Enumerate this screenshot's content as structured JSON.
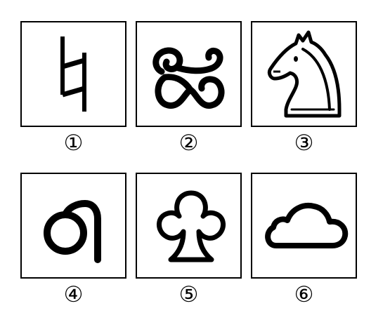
{
  "figures": [
    {
      "number": "①",
      "icon": "natural-sign-icon"
    },
    {
      "number": "②",
      "icon": "script-glyph-icon"
    },
    {
      "number": "③",
      "icon": "chess-knight-icon"
    },
    {
      "number": "④",
      "icon": "script-loop-icon"
    },
    {
      "number": "⑤",
      "icon": "club-icon"
    },
    {
      "number": "⑥",
      "icon": "cloud-icon"
    }
  ],
  "colors": {
    "stroke": "#000000",
    "background": "#ffffff"
  }
}
